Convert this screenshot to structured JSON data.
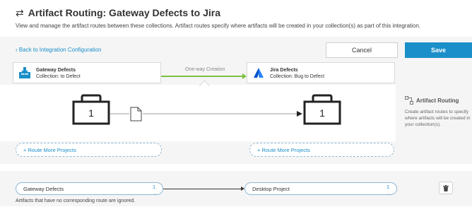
{
  "header": {
    "title": "Artifact Routing: Gateway Defects to Jira",
    "description": "View and manage the artifact routes between these collections. Artifact routes specify where artifacts will be created in your collection(s) as part of this integration."
  },
  "nav": {
    "back_label": "Back to Integration Configuration",
    "cancel_label": "Cancel",
    "save_label": "Save"
  },
  "routes": {
    "left": {
      "name": "Gateway Defects",
      "collection": "Collection: to Defect"
    },
    "right": {
      "name": "Jira Defects",
      "collection": "Collection: Bug to Defect"
    },
    "flow_label": "One-way Creation"
  },
  "canvas": {
    "left_count": "1",
    "right_count": "1"
  },
  "side_panel": {
    "title": "Artifact Routing",
    "text": "Create artifact routes to specify where artifacts will be created in your collection(s)."
  },
  "route_more": {
    "left_label": "+ Route More Projects",
    "right_label": "+ Route More Projects"
  },
  "mapping": {
    "source_label": "Gateway Defects",
    "source_count": "1",
    "target_label": "Desktop Project",
    "target_count": "1",
    "dots": "...",
    "note": "Artifacts that have no corresponding route are ignored."
  },
  "colors": {
    "accent": "#1a8fc9",
    "flow": "#7cc142",
    "jira": "#2684ff"
  }
}
